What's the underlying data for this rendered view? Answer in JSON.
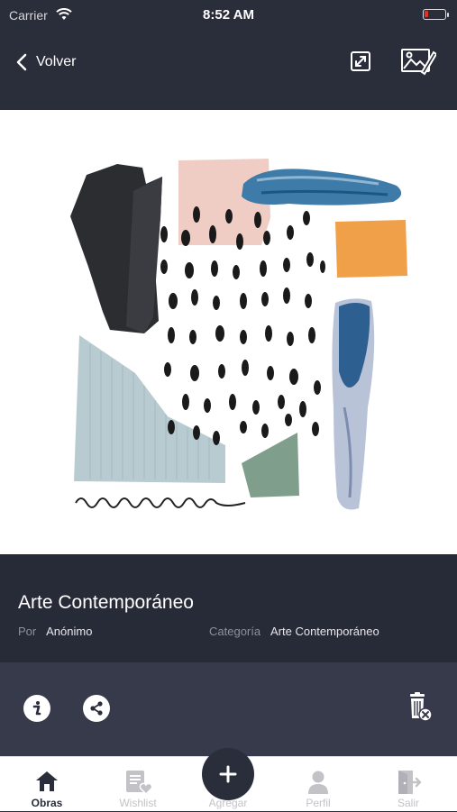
{
  "status_bar": {
    "carrier": "Carrier",
    "time": "8:52 AM"
  },
  "nav": {
    "back_label": "Volver"
  },
  "artwork": {
    "title": "Arte Contemporáneo"
  },
  "details": {
    "author_label": "Por",
    "author_value": "Anónimo",
    "category_label": "Categoría",
    "category_value": "Arte Contemporáneo"
  },
  "tabs": [
    {
      "label": "Obras",
      "icon": "home-icon",
      "active": true
    },
    {
      "label": "Wishlist",
      "icon": "wishlist-icon",
      "active": false
    },
    {
      "label": "Agregar",
      "icon": "plus-icon",
      "active": false
    },
    {
      "label": "Perfil",
      "icon": "user-icon",
      "active": false
    },
    {
      "label": "Salir",
      "icon": "exit-icon",
      "active": false
    }
  ],
  "colors": {
    "background": "#2a2d3a",
    "info_panel": "#272a37",
    "action_bar": "#363a4a",
    "tab_bar": "#ffffff",
    "battery_low": "#e0302a"
  }
}
